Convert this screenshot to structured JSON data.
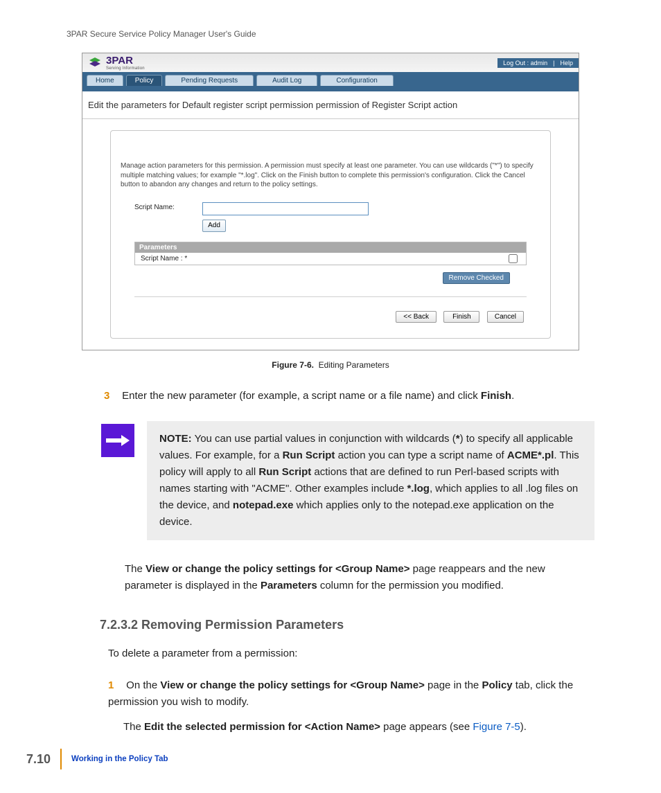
{
  "doc_header": "3PAR Secure Service Policy Manager User's Guide",
  "app": {
    "logo_text": "3PAR",
    "logo_tag": "Serving Information",
    "userbar": {
      "logout": "Log Out : admin",
      "sep": "|",
      "help": "Help"
    },
    "tabs": [
      "Home",
      "Policy",
      "Pending Requests",
      "Audit Log",
      "Configuration"
    ],
    "edit_line": "Edit the parameters for Default register script permission permission of Register Script action",
    "panel_desc": "Manage action parameters for this permission. A permission must specify at least one parameter. You can use wildcards (\"*\") to specify multiple matching values; for example \"*.log\". Click on the Finish button to complete this permission's configuration. Click the Cancel button to abandon any changes and return to the policy settings.",
    "form_label": "Script Name:",
    "add_button": "Add",
    "params_header": "Parameters",
    "params_row": "Script Name : *",
    "remove_button": "Remove Checked",
    "buttons": {
      "back": "<< Back",
      "finish": "Finish",
      "cancel": "Cancel"
    }
  },
  "figure": {
    "label": "Figure 7-6.",
    "caption": "Editing Parameters"
  },
  "step3": {
    "num": "3",
    "text_a": "Enter the new parameter (for example, a script name or a file name) and click ",
    "finish": "Finish",
    "text_b": "."
  },
  "note": {
    "label": "NOTE:",
    "t1": " You can use partial values in conjunction with wildcards (",
    "asterisk": "*",
    "t2": ") to specify all applicable values. For example, for a ",
    "runscript1": "Run Script",
    "t3": " action you can type a script name of ",
    "acme": "ACME*.pl",
    "t4": ". This policy will apply to all ",
    "runscript2": "Run Script",
    "t5": " actions that are defined to run Perl-based scripts with names starting with \"ACME\". Other examples include ",
    "starlog": "*.log",
    "t6": ", which applies to all .log files on the device, and ",
    "notepad": "notepad.exe",
    "t7": " which applies only to the notepad.exe application on the device."
  },
  "follow": {
    "t1": "The ",
    "b1": "View or change the policy settings for <Group Name>",
    "t2": " page reappears and the new parameter is displayed in the ",
    "b2": "Parameters",
    "t3": " column for the permission you modified."
  },
  "section": "7.2.3.2 Removing Permission Parameters",
  "intro": "To delete a parameter from a permission:",
  "ol2_item1": {
    "num": "1",
    "t1": "On the ",
    "b1": "View or change the policy settings for <Group Name>",
    "t2": " page in the ",
    "b2": "Policy",
    "t3": " tab, click the permission you wish to modify.",
    "cont_t1": "The ",
    "cont_b1": "Edit the selected permission for <Action Name>",
    "cont_t2": " page appears (see ",
    "figlink": "Figure 7-5",
    "cont_t3": ")."
  },
  "footer": {
    "page": "7.10",
    "title": "Working in the Policy Tab"
  }
}
